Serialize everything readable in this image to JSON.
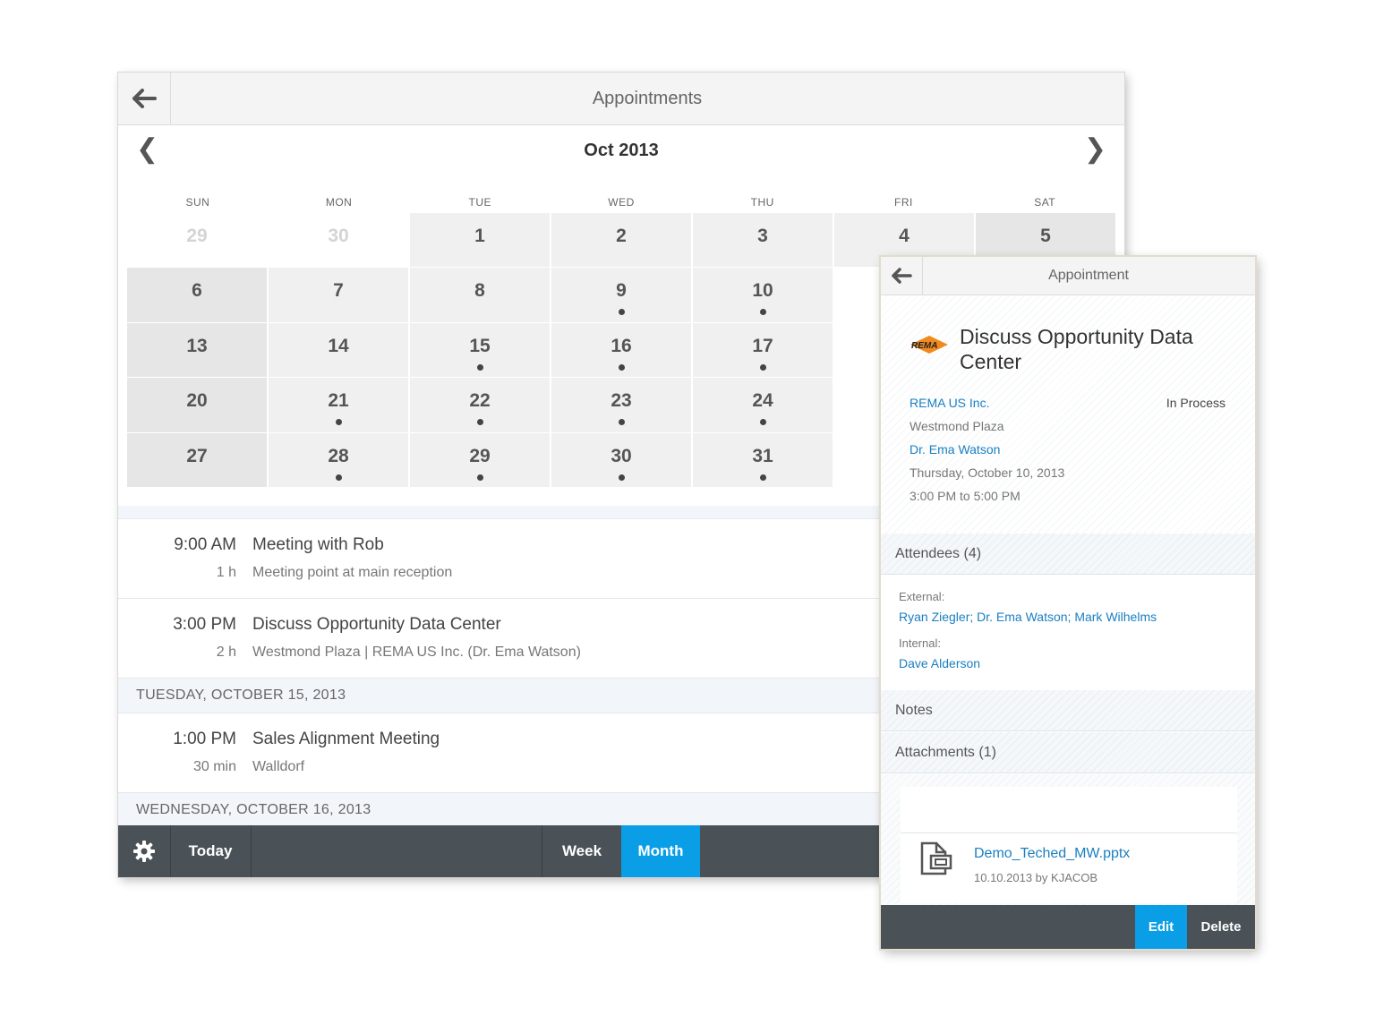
{
  "main": {
    "title": "Appointments",
    "month_label": "Oct 2013",
    "prev_icon": "chevron-left-icon",
    "next_icon": "chevron-right-icon",
    "weekdays": [
      "SUN",
      "MON",
      "TUE",
      "WED",
      "THU",
      "FRI",
      "SAT"
    ],
    "weeks": [
      [
        {
          "d": "29",
          "other": true
        },
        {
          "d": "30",
          "other": true
        },
        {
          "d": "1"
        },
        {
          "d": "2"
        },
        {
          "d": "3"
        },
        {
          "d": "4"
        },
        {
          "d": "5"
        }
      ],
      [
        {
          "d": "6"
        },
        {
          "d": "7"
        },
        {
          "d": "8"
        },
        {
          "d": "9",
          "dot": true
        },
        {
          "d": "10",
          "dot": true
        },
        {
          "d": ""
        },
        {
          "d": ""
        }
      ],
      [
        {
          "d": "13"
        },
        {
          "d": "14"
        },
        {
          "d": "15",
          "dot": true
        },
        {
          "d": "16",
          "dot": true
        },
        {
          "d": "17",
          "dot": true
        },
        {
          "d": ""
        },
        {
          "d": ""
        }
      ],
      [
        {
          "d": "20"
        },
        {
          "d": "21",
          "dot": true
        },
        {
          "d": "22",
          "dot": true
        },
        {
          "d": "23",
          "dot": true
        },
        {
          "d": "24",
          "dot": true
        },
        {
          "d": ""
        },
        {
          "d": ""
        }
      ],
      [
        {
          "d": "27"
        },
        {
          "d": "28",
          "dot": true
        },
        {
          "d": "29",
          "dot": true
        },
        {
          "d": "30",
          "dot": true
        },
        {
          "d": "31",
          "dot": true
        },
        {
          "d": ""
        },
        {
          "d": ""
        }
      ]
    ],
    "appointments_a": [
      {
        "time": "9:00 AM",
        "duration": "1 h",
        "subject": "Meeting with Rob",
        "location": "Meeting point at main reception"
      },
      {
        "time": "3:00 PM",
        "duration": "2 h",
        "subject": "Discuss Opportunity Data Center",
        "location": "Westmond Plaza | REMA US Inc. (Dr. Ema Watson)"
      }
    ],
    "day_header_1": "TUESDAY, OCTOBER 15, 2013",
    "appointments_b": [
      {
        "time": "1:00 PM",
        "duration": "30 min",
        "subject": "Sales Alignment Meeting",
        "location": "Walldorf"
      }
    ],
    "day_header_2": "WEDNESDAY, OCTOBER 16, 2013",
    "footer": {
      "settings_icon": "gear-icon",
      "today": "Today",
      "week": "Week",
      "month": "Month",
      "active_color": "#0a9ee6"
    }
  },
  "detail": {
    "title": "Appointment",
    "logo_text": "REMA",
    "subject": "Discuss Opportunity Data Center",
    "account": "REMA US Inc.",
    "status": "In Process",
    "location": "Westmond Plaza",
    "contact": "Dr. Ema Watson",
    "date": "Thursday, October 10, 2013",
    "time": "3:00 PM to 5:00 PM",
    "attendees_header": "Attendees (4)",
    "external_label": "External:",
    "external_names": "Ryan Ziegler; Dr. Ema Watson; Mark Wilhelms",
    "internal_label": "Internal:",
    "internal_names": "Dave Alderson",
    "notes_header": "Notes",
    "attachments_header": "Attachments (1)",
    "file_name": "Demo_Teched_MW.pptx",
    "file_meta": "10.10.2013 by KJACOB",
    "file_icon": "presentation-file-icon",
    "edit": "Edit",
    "delete": "Delete"
  }
}
